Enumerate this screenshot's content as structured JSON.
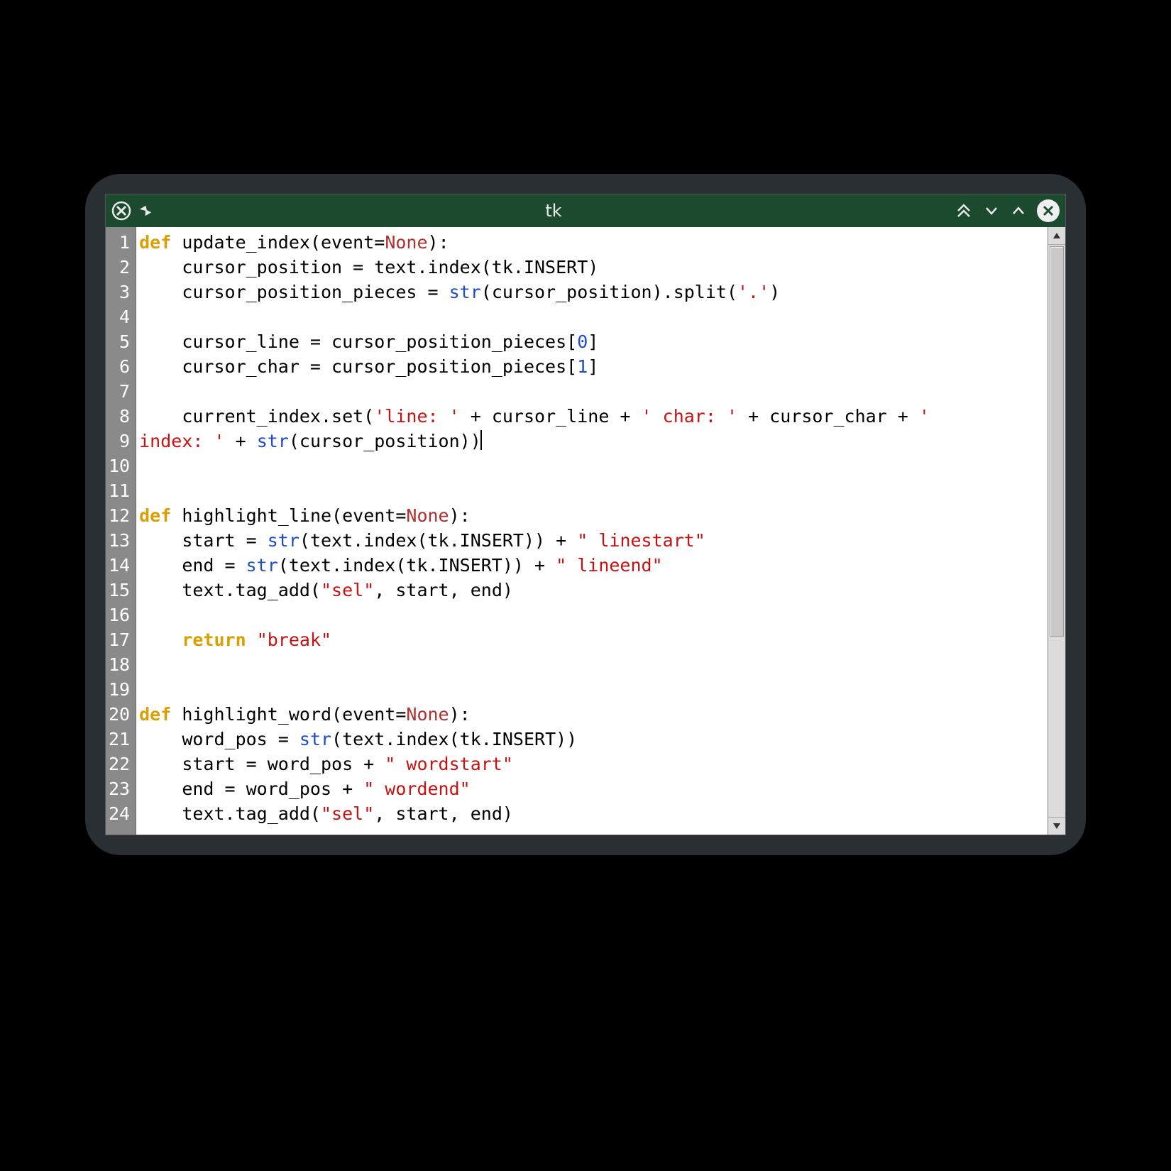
{
  "window": {
    "title": "tk"
  },
  "line_count": 24,
  "code_lines": [
    [
      {
        "t": "def ",
        "c": "kw"
      },
      {
        "t": "update_index(event=",
        "c": ""
      },
      {
        "t": "None",
        "c": "none"
      },
      {
        "t": "):",
        "c": ""
      }
    ],
    [
      {
        "t": "    cursor_position = text.index(tk.INSERT)",
        "c": ""
      }
    ],
    [
      {
        "t": "    cursor_position_pieces = ",
        "c": ""
      },
      {
        "t": "str",
        "c": "fn"
      },
      {
        "t": "(cursor_position).split(",
        "c": ""
      },
      {
        "t": "'.'",
        "c": "str"
      },
      {
        "t": ")",
        "c": ""
      }
    ],
    [],
    [
      {
        "t": "    cursor_line = cursor_position_pieces[",
        "c": ""
      },
      {
        "t": "0",
        "c": "num"
      },
      {
        "t": "]",
        "c": ""
      }
    ],
    [
      {
        "t": "    cursor_char = cursor_position_pieces[",
        "c": ""
      },
      {
        "t": "1",
        "c": "num"
      },
      {
        "t": "]",
        "c": ""
      }
    ],
    [],
    [
      {
        "t": "    current_index.set(",
        "c": ""
      },
      {
        "t": "'line: '",
        "c": "str"
      },
      {
        "t": " + cursor_line + ",
        "c": ""
      },
      {
        "t": "' char: '",
        "c": "str"
      },
      {
        "t": " + cursor_char + ",
        "c": ""
      },
      {
        "t": "'",
        "c": "str"
      }
    ],
    [
      {
        "t": "index: '",
        "c": "str"
      },
      {
        "t": " + ",
        "c": ""
      },
      {
        "t": "str",
        "c": "fn"
      },
      {
        "t": "(cursor_position))",
        "c": ""
      },
      {
        "t": "",
        "c": "cursor-marker"
      }
    ],
    [],
    [],
    [
      {
        "t": "def ",
        "c": "kw"
      },
      {
        "t": "highlight_line(event=",
        "c": ""
      },
      {
        "t": "None",
        "c": "none"
      },
      {
        "t": "):",
        "c": ""
      }
    ],
    [
      {
        "t": "    start = ",
        "c": ""
      },
      {
        "t": "str",
        "c": "fn"
      },
      {
        "t": "(text.index(tk.INSERT)) + ",
        "c": ""
      },
      {
        "t": "\" linestart\"",
        "c": "str"
      }
    ],
    [
      {
        "t": "    end = ",
        "c": ""
      },
      {
        "t": "str",
        "c": "fn"
      },
      {
        "t": "(text.index(tk.INSERT)) + ",
        "c": ""
      },
      {
        "t": "\" lineend\"",
        "c": "str"
      }
    ],
    [
      {
        "t": "    text.tag_add(",
        "c": ""
      },
      {
        "t": "\"sel\"",
        "c": "str"
      },
      {
        "t": ", start, end)",
        "c": ""
      }
    ],
    [],
    [
      {
        "t": "    ",
        "c": ""
      },
      {
        "t": "return ",
        "c": "kw"
      },
      {
        "t": "\"break\"",
        "c": "str"
      }
    ],
    [],
    [],
    [
      {
        "t": "def ",
        "c": "kw"
      },
      {
        "t": "highlight_word(event=",
        "c": ""
      },
      {
        "t": "None",
        "c": "none"
      },
      {
        "t": "):",
        "c": ""
      }
    ],
    [
      {
        "t": "    word_pos = ",
        "c": ""
      },
      {
        "t": "str",
        "c": "fn"
      },
      {
        "t": "(text.index(tk.INSERT))",
        "c": ""
      }
    ],
    [
      {
        "t": "    start = word_pos + ",
        "c": ""
      },
      {
        "t": "\" wordstart\"",
        "c": "str"
      }
    ],
    [
      {
        "t": "    end = word_pos + ",
        "c": ""
      },
      {
        "t": "\" wordend\"",
        "c": "str"
      }
    ],
    [
      {
        "t": "    text.tag_add(",
        "c": ""
      },
      {
        "t": "\"sel\"",
        "c": "str"
      },
      {
        "t": ", start, end)",
        "c": ""
      }
    ]
  ]
}
